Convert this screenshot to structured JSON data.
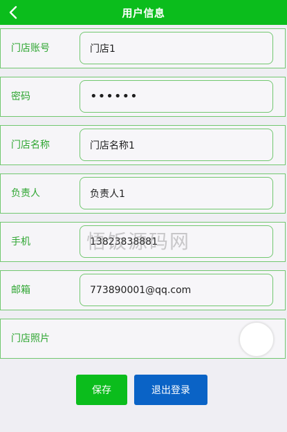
{
  "header": {
    "title": "用户信息",
    "back_icon": "chevron-left-icon"
  },
  "form": {
    "store_account": {
      "label": "门店账号",
      "value": "门店1"
    },
    "password": {
      "label": "密码",
      "value": "••••••"
    },
    "store_name": {
      "label": "门店名称",
      "value": "门店名称1"
    },
    "manager": {
      "label": "负责人",
      "value": "负责人1"
    },
    "phone": {
      "label": "手机",
      "value": "13823838881"
    },
    "email": {
      "label": "邮箱",
      "value": "773890001@qq.com"
    },
    "store_photo": {
      "label": "门店照片"
    }
  },
  "buttons": {
    "save_label": "保存",
    "logout_label": "退出登录"
  },
  "watermark": "悟饭源码网",
  "colors": {
    "header_green": "#0bbd1c",
    "label_green": "#2fa632",
    "border_green": "#71c76f",
    "logout_blue": "#0a63c6",
    "background": "#efeef3"
  }
}
